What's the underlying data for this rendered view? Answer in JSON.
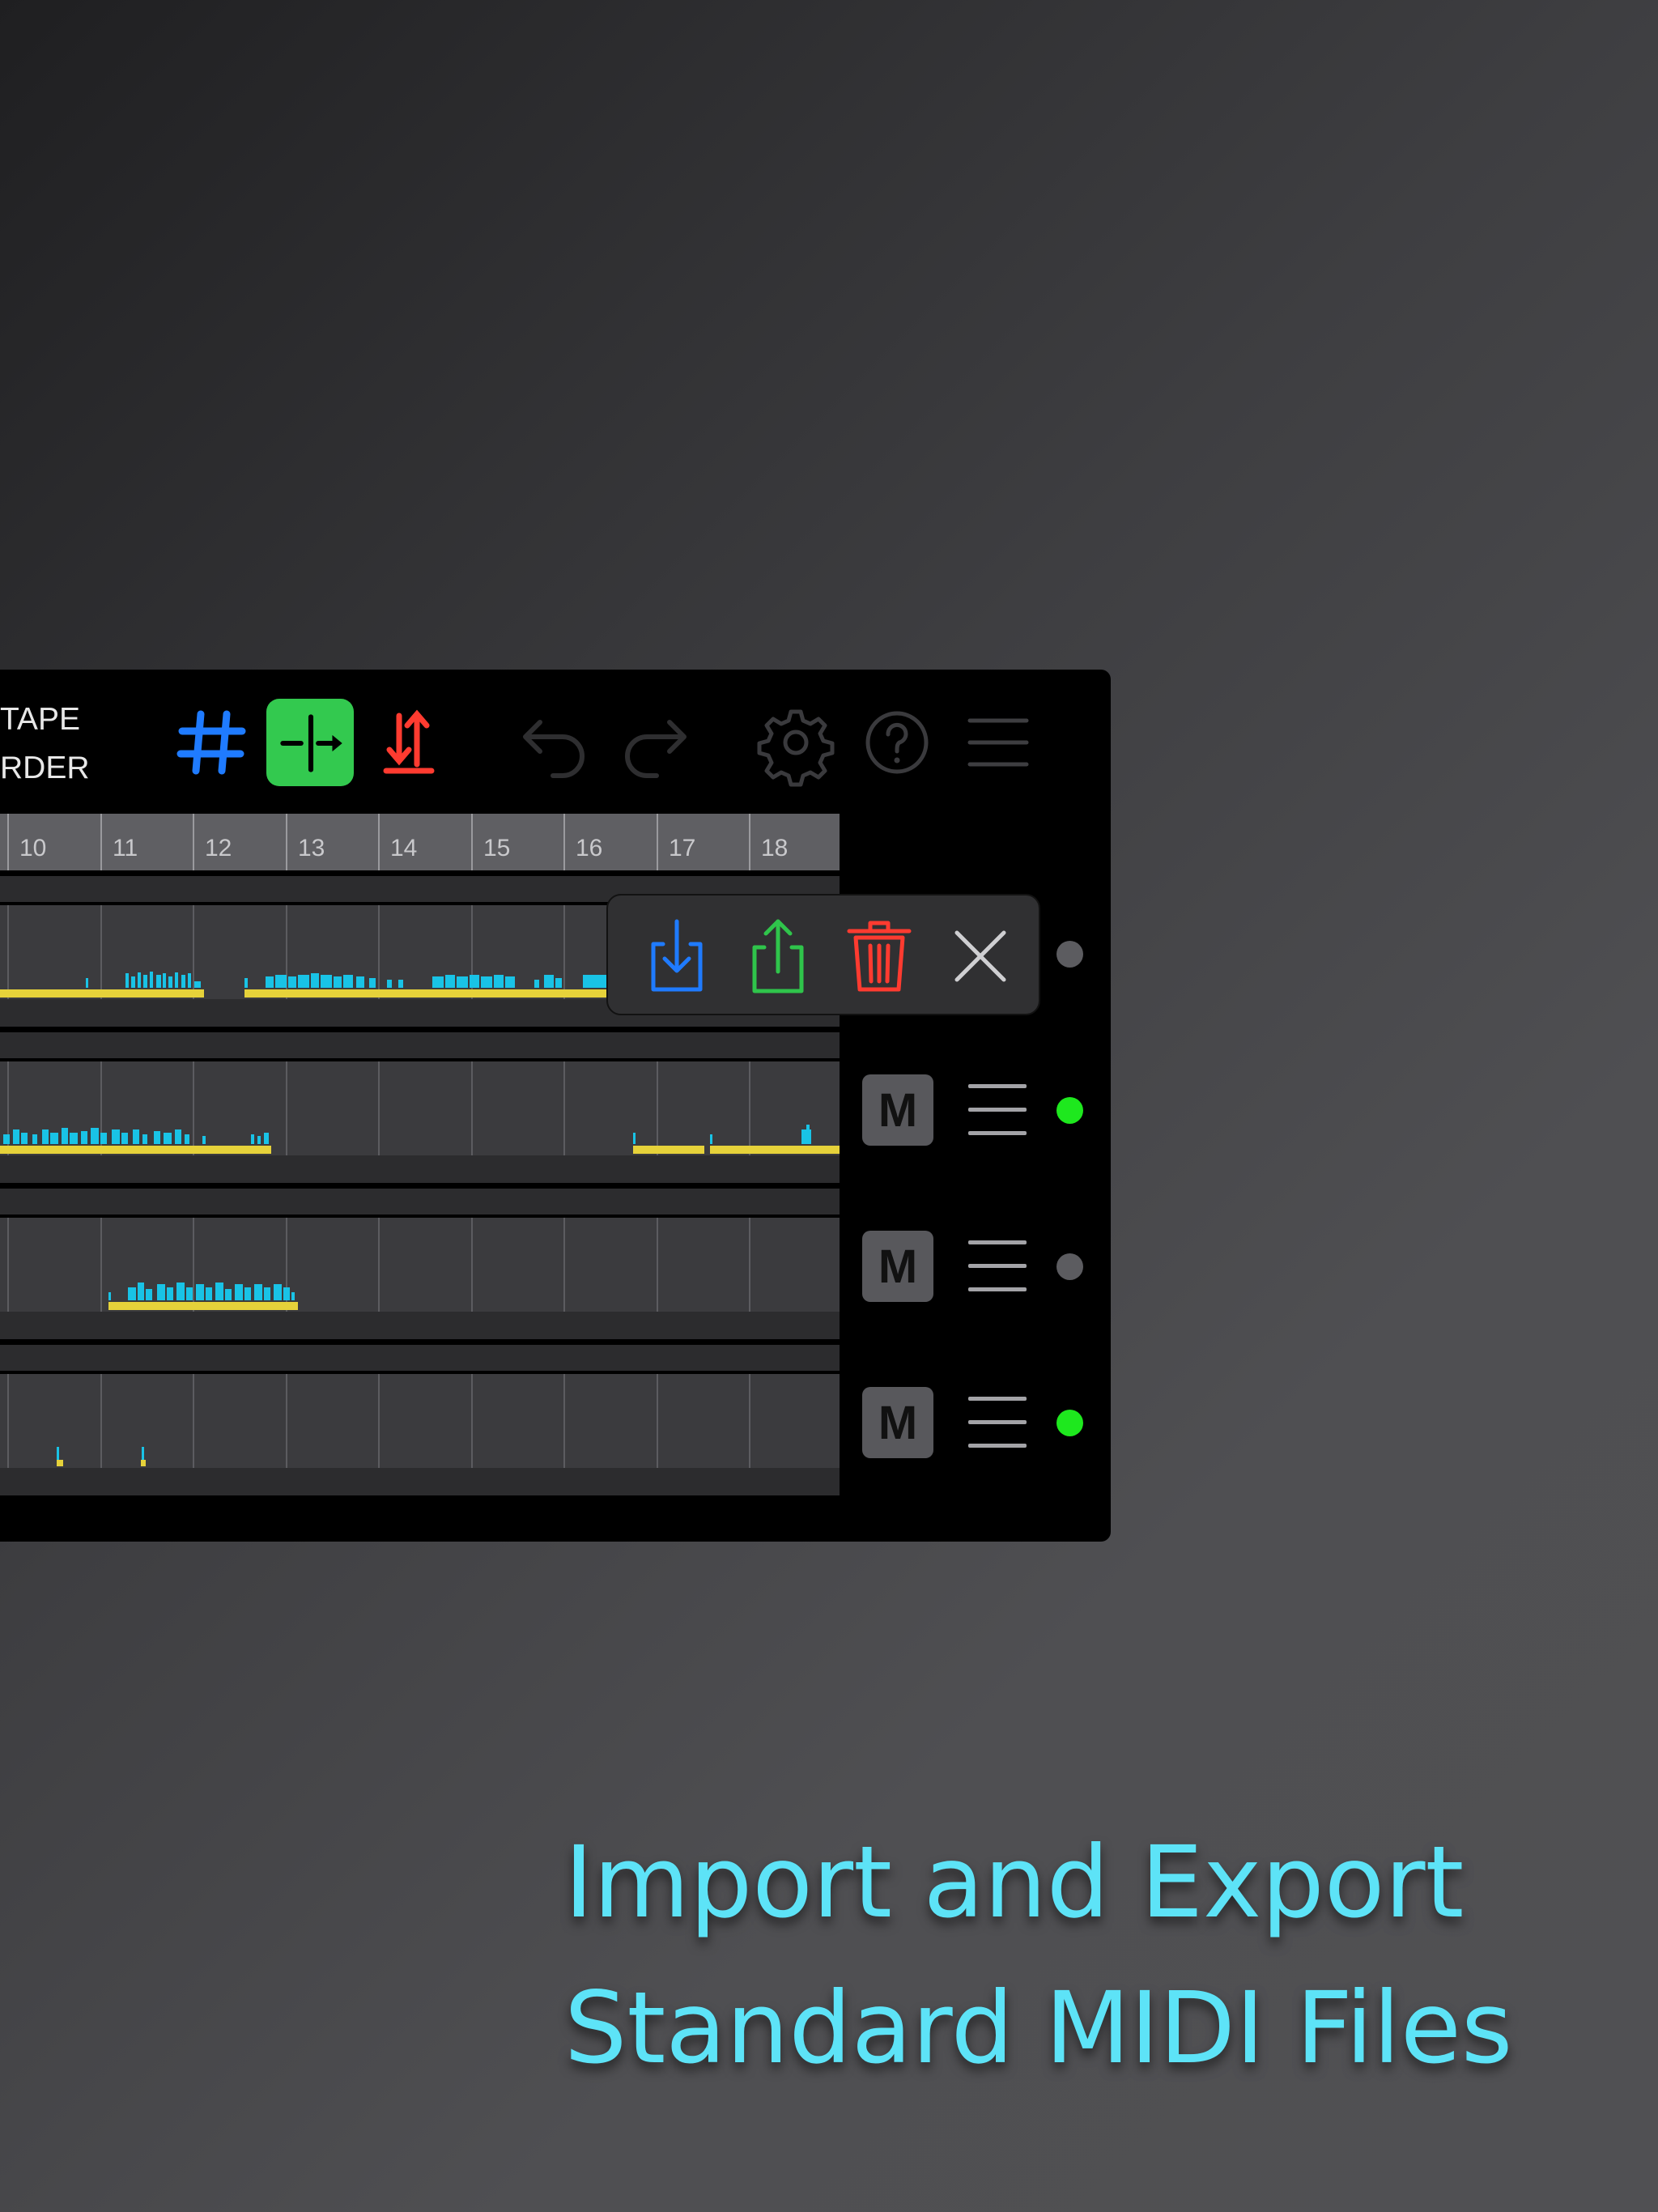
{
  "app": {
    "title_line1": "TAPE",
    "title_line2": "RDER"
  },
  "toolbar": {
    "grid_icon": "hash-grid-icon",
    "snap_icon": "split-marker-icon",
    "transpose_icon": "up-down-arrows-icon",
    "undo_icon": "undo-icon",
    "redo_icon": "redo-icon",
    "settings_icon": "gear-icon",
    "help_icon": "question-circle-icon",
    "menu_icon": "hamburger-menu-icon"
  },
  "ruler": {
    "bars": [
      "10",
      "11",
      "12",
      "13",
      "14",
      "15",
      "16",
      "17",
      "18"
    ]
  },
  "tracks": [
    {
      "mute_label": "",
      "led": "off"
    },
    {
      "mute_label": "M",
      "led": "on"
    },
    {
      "mute_label": "M",
      "led": "off"
    },
    {
      "mute_label": "M",
      "led": "on"
    }
  ],
  "popover": {
    "import_icon": "import-download-icon",
    "export_icon": "export-share-icon",
    "delete_icon": "trash-icon",
    "close_icon": "close-x-icon"
  },
  "colors": {
    "accent_blue": "#1f7bff",
    "snap_green": "#33c94f",
    "transpose_red": "#ff3b30",
    "note_cyan": "#19c3e6",
    "clip_yellow": "#e6d23a",
    "led_on": "#1ee81e",
    "led_off": "#5c5c60",
    "caption": "#5de3f7"
  },
  "caption": {
    "line1": "Import and Export",
    "line2": "Standard MIDI Files"
  }
}
